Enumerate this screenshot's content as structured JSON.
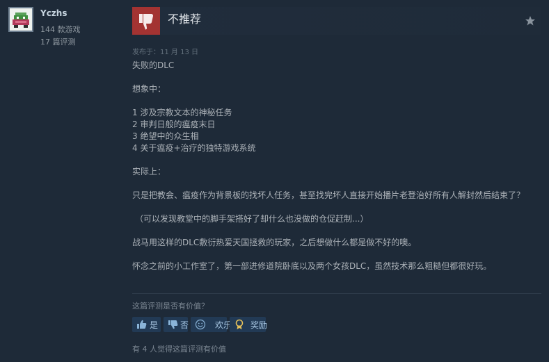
{
  "author": {
    "name": "Yczhs",
    "games_owned": "144 款游戏",
    "reviews_count": "17 篇评测"
  },
  "review": {
    "verdict": "不推荐",
    "posted_date": "发布于：11 月 13 日",
    "paragraphs": [
      "失败的DLC",
      "想象中：",
      "1 涉及宗教文本的神秘任务\n2 审判日般的瘟疫末日\n3 绝望中的众生相\n4 关于瘟疫+治疗的独特游戏系统",
      "实际上：",
      "只是把教会、瘟疫作为背景板的找坏人任务，甚至找完坏人直接开始播片老登治好所有人解封然后结束了？",
      "（可以发现教堂中的脚手架搭好了却什么也没做的仓促赶制...）",
      "战马用这样的DLC敷衍热爱天国拯救的玩家，之后想做什么都是做不好的噢。",
      "怀念之前的小工作室了，第一部进修道院卧底以及两个女孩DLC，虽然技术那么粗糙但都很好玩。"
    ]
  },
  "feedback": {
    "question": "这篇评测是否有价值？",
    "yes_label": "是",
    "no_label": "否",
    "funny_label": "欢乐",
    "award_label": "奖励",
    "helpful_count": "有 4 人觉得这篇评测有价值"
  },
  "colors": {
    "background": "#1e2a38",
    "thumb_down_box": "#a33332",
    "vote_button": "#223a55",
    "award_icon": "#e5c15b"
  }
}
